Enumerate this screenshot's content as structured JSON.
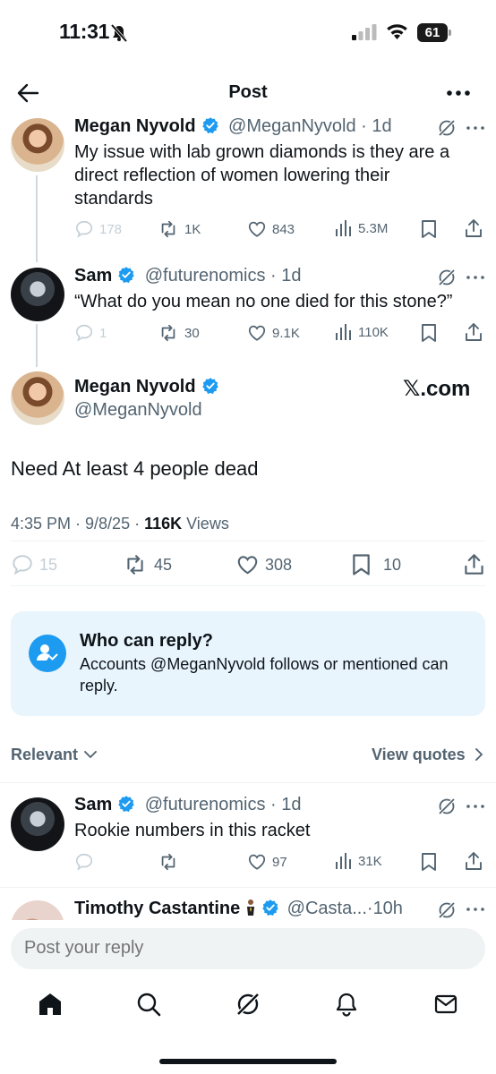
{
  "status_bar": {
    "time": "11:31",
    "battery": "61"
  },
  "header": {
    "title": "Post"
  },
  "thread": [
    {
      "name": "Megan Nyvold",
      "handle": "@MeganNyvold",
      "age": "1d",
      "text_lines": [
        "My issue with lab grown diamonds is they are a",
        "direct reflection of women lowering their",
        "standards"
      ],
      "stats": {
        "replies": "178",
        "reposts": "1K",
        "likes": "843",
        "views": "5.3M"
      }
    },
    {
      "name": "Sam",
      "handle": "@futurenomics",
      "age": "1d",
      "text_lines": [
        "“What do you mean no one died for this stone?”"
      ],
      "stats": {
        "replies": "1",
        "reposts": "30",
        "likes": "9.1K",
        "views": "110K"
      }
    }
  ],
  "main_post": {
    "name": "Megan Nyvold",
    "handle": "@MeganNyvold",
    "source": "𝕏.com",
    "text": "Need At least 4 people dead",
    "time": "4:35 PM · 9/8/25 · ",
    "views_count": "116K",
    "views_label": " Views",
    "stats": {
      "replies": "15",
      "reposts": "45",
      "likes": "308",
      "bookmarks": "10"
    }
  },
  "who_can_reply": {
    "title": "Who can reply?",
    "description": "Accounts @MeganNyvold follows or mentioned can reply."
  },
  "sort": {
    "relevant": "Relevant",
    "view_quotes": "View quotes"
  },
  "replies": [
    {
      "name": "Sam",
      "handle": "@futurenomics",
      "age": "1d",
      "text": "Rookie numbers in this racket",
      "stats": {
        "likes": "97",
        "views": "31K"
      }
    },
    {
      "name": "Timothy Castantine",
      "handle": "@Casta...",
      "age": "10h"
    }
  ],
  "reply_bar": {
    "placeholder": "Post your reply"
  },
  "colors": {
    "accent": "#1d9bf0",
    "text": "#0f1419",
    "muted": "#536471",
    "who_bg": "#e8f5fd"
  }
}
